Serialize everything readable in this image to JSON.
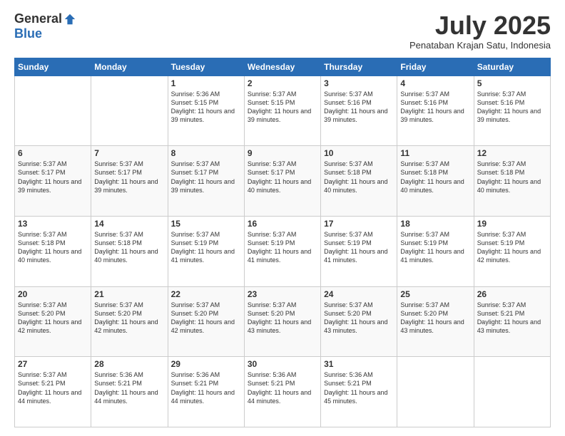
{
  "header": {
    "logo_general": "General",
    "logo_blue": "Blue",
    "month_title": "July 2025",
    "subtitle": "Penataban Krajan Satu, Indonesia"
  },
  "weekdays": [
    "Sunday",
    "Monday",
    "Tuesday",
    "Wednesday",
    "Thursday",
    "Friday",
    "Saturday"
  ],
  "weeks": [
    [
      {
        "day": "",
        "info": ""
      },
      {
        "day": "",
        "info": ""
      },
      {
        "day": "1",
        "info": "Sunrise: 5:36 AM\nSunset: 5:15 PM\nDaylight: 11 hours and 39 minutes."
      },
      {
        "day": "2",
        "info": "Sunrise: 5:37 AM\nSunset: 5:15 PM\nDaylight: 11 hours and 39 minutes."
      },
      {
        "day": "3",
        "info": "Sunrise: 5:37 AM\nSunset: 5:16 PM\nDaylight: 11 hours and 39 minutes."
      },
      {
        "day": "4",
        "info": "Sunrise: 5:37 AM\nSunset: 5:16 PM\nDaylight: 11 hours and 39 minutes."
      },
      {
        "day": "5",
        "info": "Sunrise: 5:37 AM\nSunset: 5:16 PM\nDaylight: 11 hours and 39 minutes."
      }
    ],
    [
      {
        "day": "6",
        "info": "Sunrise: 5:37 AM\nSunset: 5:17 PM\nDaylight: 11 hours and 39 minutes."
      },
      {
        "day": "7",
        "info": "Sunrise: 5:37 AM\nSunset: 5:17 PM\nDaylight: 11 hours and 39 minutes."
      },
      {
        "day": "8",
        "info": "Sunrise: 5:37 AM\nSunset: 5:17 PM\nDaylight: 11 hours and 39 minutes."
      },
      {
        "day": "9",
        "info": "Sunrise: 5:37 AM\nSunset: 5:17 PM\nDaylight: 11 hours and 40 minutes."
      },
      {
        "day": "10",
        "info": "Sunrise: 5:37 AM\nSunset: 5:18 PM\nDaylight: 11 hours and 40 minutes."
      },
      {
        "day": "11",
        "info": "Sunrise: 5:37 AM\nSunset: 5:18 PM\nDaylight: 11 hours and 40 minutes."
      },
      {
        "day": "12",
        "info": "Sunrise: 5:37 AM\nSunset: 5:18 PM\nDaylight: 11 hours and 40 minutes."
      }
    ],
    [
      {
        "day": "13",
        "info": "Sunrise: 5:37 AM\nSunset: 5:18 PM\nDaylight: 11 hours and 40 minutes."
      },
      {
        "day": "14",
        "info": "Sunrise: 5:37 AM\nSunset: 5:18 PM\nDaylight: 11 hours and 40 minutes."
      },
      {
        "day": "15",
        "info": "Sunrise: 5:37 AM\nSunset: 5:19 PM\nDaylight: 11 hours and 41 minutes."
      },
      {
        "day": "16",
        "info": "Sunrise: 5:37 AM\nSunset: 5:19 PM\nDaylight: 11 hours and 41 minutes."
      },
      {
        "day": "17",
        "info": "Sunrise: 5:37 AM\nSunset: 5:19 PM\nDaylight: 11 hours and 41 minutes."
      },
      {
        "day": "18",
        "info": "Sunrise: 5:37 AM\nSunset: 5:19 PM\nDaylight: 11 hours and 41 minutes."
      },
      {
        "day": "19",
        "info": "Sunrise: 5:37 AM\nSunset: 5:19 PM\nDaylight: 11 hours and 42 minutes."
      }
    ],
    [
      {
        "day": "20",
        "info": "Sunrise: 5:37 AM\nSunset: 5:20 PM\nDaylight: 11 hours and 42 minutes."
      },
      {
        "day": "21",
        "info": "Sunrise: 5:37 AM\nSunset: 5:20 PM\nDaylight: 11 hours and 42 minutes."
      },
      {
        "day": "22",
        "info": "Sunrise: 5:37 AM\nSunset: 5:20 PM\nDaylight: 11 hours and 42 minutes."
      },
      {
        "day": "23",
        "info": "Sunrise: 5:37 AM\nSunset: 5:20 PM\nDaylight: 11 hours and 43 minutes."
      },
      {
        "day": "24",
        "info": "Sunrise: 5:37 AM\nSunset: 5:20 PM\nDaylight: 11 hours and 43 minutes."
      },
      {
        "day": "25",
        "info": "Sunrise: 5:37 AM\nSunset: 5:20 PM\nDaylight: 11 hours and 43 minutes."
      },
      {
        "day": "26",
        "info": "Sunrise: 5:37 AM\nSunset: 5:21 PM\nDaylight: 11 hours and 43 minutes."
      }
    ],
    [
      {
        "day": "27",
        "info": "Sunrise: 5:37 AM\nSunset: 5:21 PM\nDaylight: 11 hours and 44 minutes."
      },
      {
        "day": "28",
        "info": "Sunrise: 5:36 AM\nSunset: 5:21 PM\nDaylight: 11 hours and 44 minutes."
      },
      {
        "day": "29",
        "info": "Sunrise: 5:36 AM\nSunset: 5:21 PM\nDaylight: 11 hours and 44 minutes."
      },
      {
        "day": "30",
        "info": "Sunrise: 5:36 AM\nSunset: 5:21 PM\nDaylight: 11 hours and 44 minutes."
      },
      {
        "day": "31",
        "info": "Sunrise: 5:36 AM\nSunset: 5:21 PM\nDaylight: 11 hours and 45 minutes."
      },
      {
        "day": "",
        "info": ""
      },
      {
        "day": "",
        "info": ""
      }
    ]
  ]
}
